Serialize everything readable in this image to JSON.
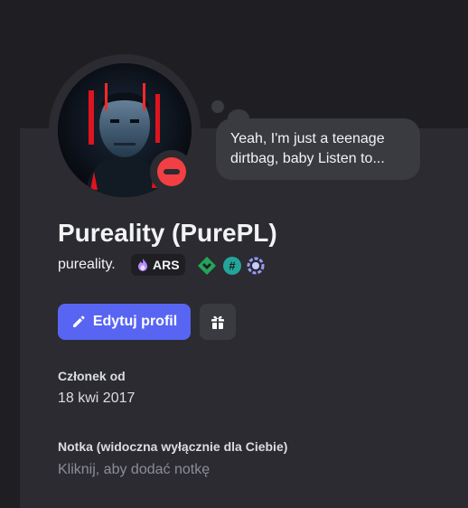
{
  "profile": {
    "display_name": "Pureality (PurePL)",
    "username": "pureality.",
    "status": "do-not-disturb",
    "custom_status": "Yeah, I'm just a teenage dirtbag, baby Listen to...",
    "tag": {
      "icon": "flame-icon",
      "text": "ARS"
    },
    "badges": [
      "nitro-diamond-icon",
      "hashtag-badge-icon",
      "quest-badge-icon"
    ]
  },
  "actions": {
    "edit_profile": "Edytuj profil",
    "gift_icon": "gift-icon"
  },
  "member_since": {
    "label": "Członek od",
    "date": "18 kwi 2017"
  },
  "note": {
    "label": "Notka (widoczna wyłącznie dla Ciebie)",
    "placeholder": "Kliknij, aby dodać notkę"
  },
  "colors": {
    "accent": "#5865f2",
    "dnd": "#f23f43",
    "card_bg": "#2b2b31",
    "badge_teal": "#23a55a",
    "badge_purple": "#949cf7"
  }
}
